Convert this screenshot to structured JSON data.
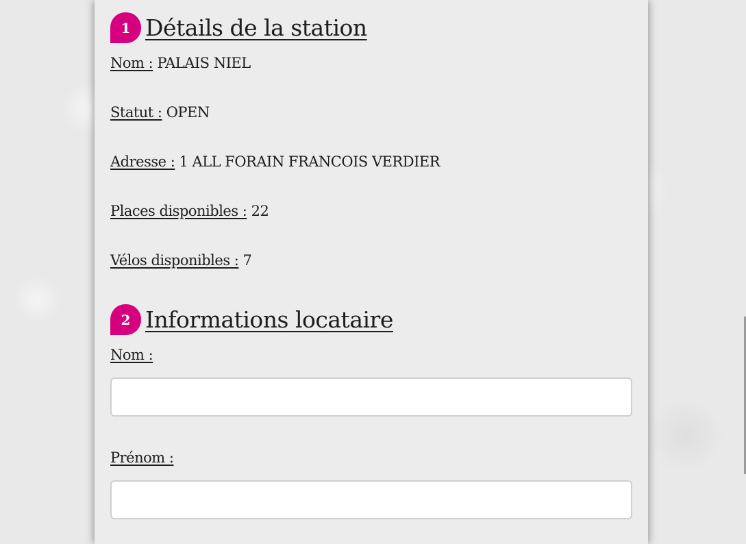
{
  "station_section": {
    "number": "1",
    "title": "Détails de la station",
    "fields": [
      {
        "label": "Nom :",
        "value": "PALAIS NIEL"
      },
      {
        "label": "Statut :",
        "value": "OPEN"
      },
      {
        "label": "Adresse :",
        "value": "1 ALL FORAIN FRANCOIS VERDIER"
      },
      {
        "label": "Places disponibles :",
        "value": "22"
      },
      {
        "label": "Vélos disponibles :",
        "value": "7"
      }
    ]
  },
  "renter_section": {
    "number": "2",
    "title": "Informations locataire",
    "lastname_label": "Nom :",
    "lastname_value": "",
    "firstname_label": "Prénom :",
    "firstname_value": ""
  },
  "colors": {
    "accent": "#d6007f",
    "panel": "#ececec",
    "text": "#1d1d1d"
  }
}
